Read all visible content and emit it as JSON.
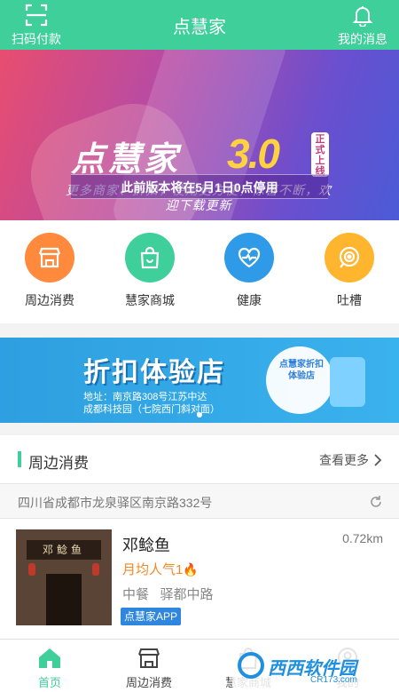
{
  "header": {
    "title": "点慧家",
    "scan_label": "扫码付款",
    "messages_label": "我的消息",
    "bg_color": "#3fcf9b"
  },
  "banner": {
    "headline": "点慧家",
    "version": "3.0",
    "tag": "正式上线",
    "subtitle": "更多商家、折扣，使用更方便，惊喜不断，欢迎下载更新",
    "notice": "此前版本将在5月1日0点停用"
  },
  "quick_nav": [
    {
      "label": "周边消费",
      "icon": "store-icon",
      "color": "#ff8a3d"
    },
    {
      "label": "慧家商城",
      "icon": "shopping-bag-icon",
      "color": "#3fcf9b"
    },
    {
      "label": "健康",
      "icon": "heart-pulse-icon",
      "color": "#2f9be8"
    },
    {
      "label": "吐槽",
      "icon": "feedback-icon",
      "color": "#ffb52e"
    }
  ],
  "promo": {
    "title": "折扣体验店",
    "address_line1": "地址：南京路308号江苏中达",
    "address_line2": "成都科技园（七院西门斜对面）",
    "badge": "点慧家折扣体验店"
  },
  "nearby": {
    "section_title": "周边消费",
    "more_label": "查看更多",
    "address": "四川省成都市龙泉驿区南京路332号",
    "shops": [
      {
        "name": "邓鲶鱼",
        "distance": "0.72km",
        "popularity": "月均人气1",
        "category": "中餐",
        "area": "驿都中路",
        "app_badge": "点慧家APP",
        "sign_text": "邓鲶鱼"
      }
    ]
  },
  "tabbar": {
    "tabs": [
      {
        "label": "首页",
        "icon": "home-icon",
        "active": true
      },
      {
        "label": "周边消费",
        "icon": "store-icon",
        "active": false
      },
      {
        "label": "慧家商城",
        "icon": "shopping-bag-icon",
        "active": false
      },
      {
        "label": "我的",
        "icon": "user-icon",
        "active": false
      }
    ],
    "active_color": "#3fcf9b"
  },
  "watermark": {
    "text": "西西软件园",
    "sub": "CR173.com"
  }
}
